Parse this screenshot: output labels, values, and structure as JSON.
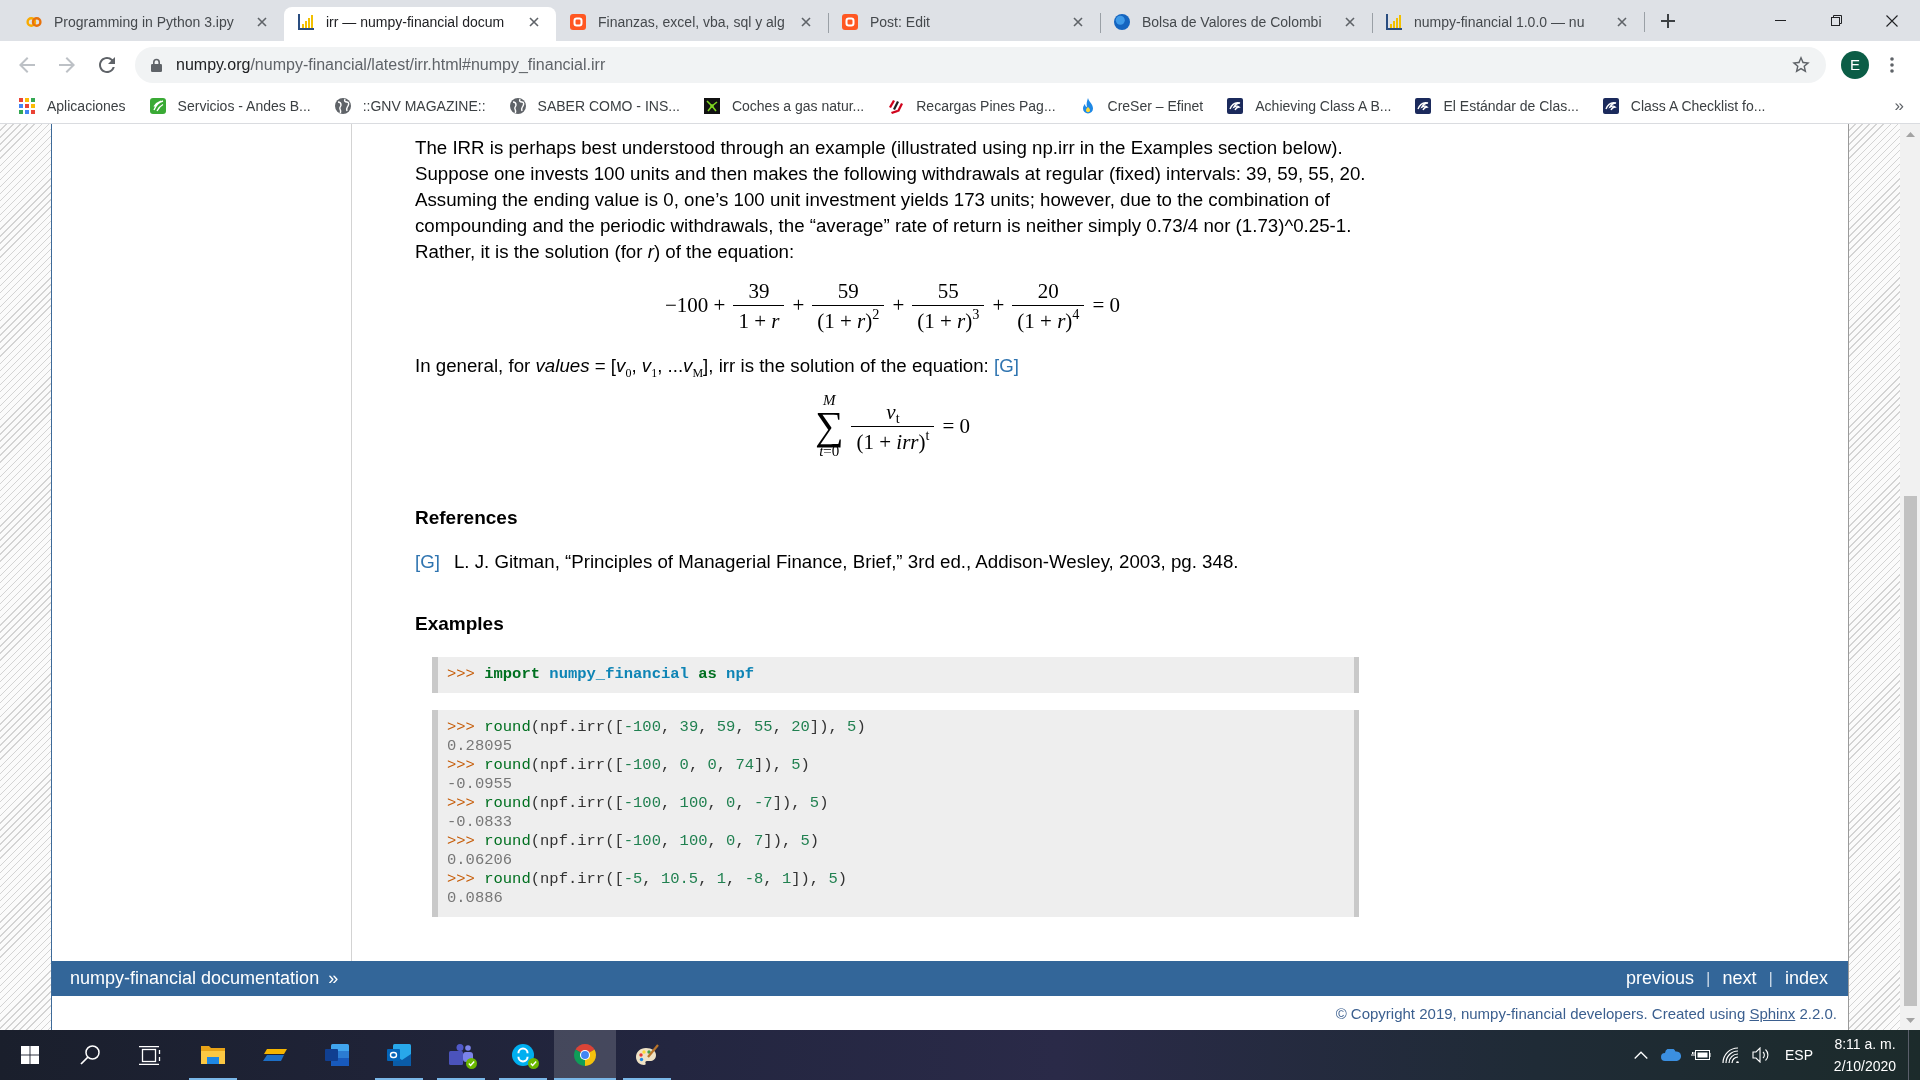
{
  "browser": {
    "tabs": [
      {
        "kind": "rings",
        "title": "Programming in Python 3.ipy",
        "selected": false
      },
      {
        "kind": "bars",
        "title": "irr — numpy-financial docum",
        "selected": true
      },
      {
        "kind": "tile",
        "title": "Finanzas, excel, vba, sql y alg",
        "selected": false
      },
      {
        "kind": "tile",
        "title": "Post: Edit",
        "selected": false
      },
      {
        "kind": "sphere",
        "title": "Bolsa de Valores de Colombi",
        "selected": false
      },
      {
        "kind": "bars",
        "title": "numpy-financial 1.0.0 — nu",
        "selected": false
      }
    ],
    "nav": [
      {
        "kind": "back",
        "disabled": true
      },
      {
        "kind": "forward",
        "disabled": true
      },
      {
        "kind": "reload",
        "disabled": false
      }
    ],
    "url": {
      "host": "numpy.org",
      "path": "/numpy-financial/latest/irr.html#numpy_financial.irr"
    },
    "avatar": "E",
    "bookmarks": [
      {
        "kind": "grid",
        "label": "Aplicaciones"
      },
      {
        "kind": "stripes",
        "label": "Servicios - Andes B..."
      },
      {
        "kind": "globe",
        "label": "::GNV MAGAZINE::"
      },
      {
        "kind": "globe",
        "label": "SABER COMO - INS..."
      },
      {
        "kind": "network",
        "label": "Coches a gas natur..."
      },
      {
        "kind": "flag",
        "label": "Recargas Pines Pag..."
      },
      {
        "kind": "flame",
        "label": "CreSer – Efinet"
      },
      {
        "kind": "swirl",
        "label": "Achieving Class A B..."
      },
      {
        "kind": "swirl",
        "label": "El Estándar de Clas..."
      },
      {
        "kind": "swirl",
        "label": "Class A Checklist fo..."
      }
    ],
    "bookmarks_more": "»"
  },
  "document": {
    "intro": "The IRR is perhaps best understood through an example (illustrated using np.irr in the Examples section below). Suppose one invests 100 units and then makes the following withdrawals at regular (fixed) intervals: 39, 59, 55, 20. Assuming the ending value is 0, one’s 100 unit investment yields 173 units; however, due to the combination of compounding and the periodic withdrawals, the “average” rate of return is neither simply 0.73/4 nor (1.73)^0.25-1. Rather, it is the solution (for *r*) of the equation:",
    "equation": [
      {
        "kind": "text",
        "text": "−100 +"
      },
      {
        "kind": "fraction",
        "numerator": "39",
        "denominator": "1 + *r*"
      },
      {
        "kind": "text",
        "text": "+"
      },
      {
        "kind": "fraction",
        "numerator": "59",
        "denominator": "(1 + *r*)$^{2}$"
      },
      {
        "kind": "text",
        "text": "+"
      },
      {
        "kind": "fraction",
        "numerator": "55",
        "denominator": "(1 + *r*)$^{3}$"
      },
      {
        "kind": "text",
        "text": "+"
      },
      {
        "kind": "fraction",
        "numerator": "20",
        "denominator": "(1 + *r*)$^{4}$"
      },
      {
        "kind": "text",
        "text": "= 0"
      }
    ],
    "general": {
      "text": "In general, for *values* = [*v*$_{0}$, *v*$_{1}$, ...*v*$_{M}$], irr is the solution of the equation:",
      "link": "[G]"
    },
    "sum_equation": [
      {
        "kind": "sum",
        "symbol": "∑",
        "upper": "*M*",
        "lower": "*t*=0"
      },
      {
        "kind": "fraction",
        "numerator": "*v*$_{t}$",
        "denominator": "(1 + *irr*)$^{t}$"
      },
      {
        "kind": "text",
        "text": "= 0"
      }
    ],
    "references": {
      "heading": "References",
      "items": [
        {
          "label": "[G]",
          "text": "L. J. Gitman, “Principles of Managerial Finance, Brief,” 3rd ed., Addison-Wesley, 2003, pg. 348."
        }
      ]
    },
    "examples": {
      "heading": "Examples",
      "blocks": [
        {
          "lines": [
            [
              {
                "kind": "prompt",
                "text": ">>> "
              },
              {
                "kind": "keyword",
                "text": "import "
              },
              {
                "kind": "module",
                "text": "numpy_financial "
              },
              {
                "kind": "keyword",
                "text": "as "
              },
              {
                "kind": "module",
                "text": "npf"
              }
            ]
          ]
        },
        {
          "lines": [
            [
              {
                "kind": "prompt",
                "text": ">>> "
              },
              {
                "kind": "builtin",
                "text": "round"
              },
              {
                "kind": "punct",
                "text": "(npf.irr(["
              },
              {
                "kind": "number",
                "text": "-100"
              },
              {
                "kind": "punct",
                "text": ", "
              },
              {
                "kind": "number",
                "text": "39"
              },
              {
                "kind": "punct",
                "text": ", "
              },
              {
                "kind": "number",
                "text": "59"
              },
              {
                "kind": "punct",
                "text": ", "
              },
              {
                "kind": "number",
                "text": "55"
              },
              {
                "kind": "punct",
                "text": ", "
              },
              {
                "kind": "number",
                "text": "20"
              },
              {
                "kind": "punct",
                "text": "]), "
              },
              {
                "kind": "number",
                "text": "5"
              },
              {
                "kind": "punct",
                "text": ")"
              }
            ],
            [
              {
                "kind": "output",
                "text": "0.28095"
              }
            ],
            [
              {
                "kind": "prompt",
                "text": ">>> "
              },
              {
                "kind": "builtin",
                "text": "round"
              },
              {
                "kind": "punct",
                "text": "(npf.irr(["
              },
              {
                "kind": "number",
                "text": "-100"
              },
              {
                "kind": "punct",
                "text": ", "
              },
              {
                "kind": "number",
                "text": "0"
              },
              {
                "kind": "punct",
                "text": ", "
              },
              {
                "kind": "number",
                "text": "0"
              },
              {
                "kind": "punct",
                "text": ", "
              },
              {
                "kind": "number",
                "text": "74"
              },
              {
                "kind": "punct",
                "text": "]), "
              },
              {
                "kind": "number",
                "text": "5"
              },
              {
                "kind": "punct",
                "text": ")"
              }
            ],
            [
              {
                "kind": "output",
                "text": "-0.0955"
              }
            ],
            [
              {
                "kind": "prompt",
                "text": ">>> "
              },
              {
                "kind": "builtin",
                "text": "round"
              },
              {
                "kind": "punct",
                "text": "(npf.irr(["
              },
              {
                "kind": "number",
                "text": "-100"
              },
              {
                "kind": "punct",
                "text": ", "
              },
              {
                "kind": "number",
                "text": "100"
              },
              {
                "kind": "punct",
                "text": ", "
              },
              {
                "kind": "number",
                "text": "0"
              },
              {
                "kind": "punct",
                "text": ", "
              },
              {
                "kind": "number",
                "text": "-7"
              },
              {
                "kind": "punct",
                "text": "]), "
              },
              {
                "kind": "number",
                "text": "5"
              },
              {
                "kind": "punct",
                "text": ")"
              }
            ],
            [
              {
                "kind": "output",
                "text": "-0.0833"
              }
            ],
            [
              {
                "kind": "prompt",
                "text": ">>> "
              },
              {
                "kind": "builtin",
                "text": "round"
              },
              {
                "kind": "punct",
                "text": "(npf.irr(["
              },
              {
                "kind": "number",
                "text": "-100"
              },
              {
                "kind": "punct",
                "text": ", "
              },
              {
                "kind": "number",
                "text": "100"
              },
              {
                "kind": "punct",
                "text": ", "
              },
              {
                "kind": "number",
                "text": "0"
              },
              {
                "kind": "punct",
                "text": ", "
              },
              {
                "kind": "number",
                "text": "7"
              },
              {
                "kind": "punct",
                "text": "]), "
              },
              {
                "kind": "number",
                "text": "5"
              },
              {
                "kind": "punct",
                "text": ")"
              }
            ],
            [
              {
                "kind": "output",
                "text": "0.06206"
              }
            ],
            [
              {
                "kind": "prompt",
                "text": ">>> "
              },
              {
                "kind": "builtin",
                "text": "round"
              },
              {
                "kind": "punct",
                "text": "(npf.irr(["
              },
              {
                "kind": "number",
                "text": "-5"
              },
              {
                "kind": "punct",
                "text": ", "
              },
              {
                "kind": "number",
                "text": "10.5"
              },
              {
                "kind": "punct",
                "text": ", "
              },
              {
                "kind": "number",
                "text": "1"
              },
              {
                "kind": "punct",
                "text": ", "
              },
              {
                "kind": "number",
                "text": "-8"
              },
              {
                "kind": "punct",
                "text": ", "
              },
              {
                "kind": "number",
                "text": "1"
              },
              {
                "kind": "punct",
                "text": "]), "
              },
              {
                "kind": "number",
                "text": "5"
              },
              {
                "kind": "punct",
                "text": ")"
              }
            ],
            [
              {
                "kind": "output",
                "text": "0.0886"
              }
            ]
          ]
        }
      ]
    }
  },
  "footer": {
    "home": "numpy-financial documentation",
    "arrow": "»",
    "nav": [
      {
        "kind": "link",
        "text": "previous"
      },
      {
        "kind": "separator",
        "text": "|"
      },
      {
        "kind": "link",
        "text": "next"
      },
      {
        "kind": "separator",
        "text": "|"
      },
      {
        "kind": "link",
        "text": "index"
      }
    ],
    "copyright": {
      "text": "© Copyright 2019, numpy-financial developers. Created using",
      "link": "Sphinx",
      "after": "2.2.0."
    }
  },
  "taskbar": {
    "apps": [
      {
        "kind": "folder",
        "running": true,
        "selected": false,
        "badge": false
      },
      {
        "kind": "slanted",
        "running": false,
        "selected": false,
        "badge": false
      },
      {
        "kind": "document",
        "running": false,
        "selected": false,
        "badge": false
      },
      {
        "kind": "mail",
        "running": true,
        "selected": false,
        "badge": false
      },
      {
        "kind": "people",
        "running": true,
        "selected": false,
        "badge": true
      },
      {
        "kind": "chat",
        "running": true,
        "selected": false,
        "badge": true
      },
      {
        "kind": "ring",
        "running": true,
        "selected": true,
        "badge": false
      },
      {
        "kind": "palette",
        "running": true,
        "selected": false,
        "badge": false
      }
    ],
    "language": "ESP",
    "time": "8:11 a. m.",
    "date": "2/10/2020"
  }
}
